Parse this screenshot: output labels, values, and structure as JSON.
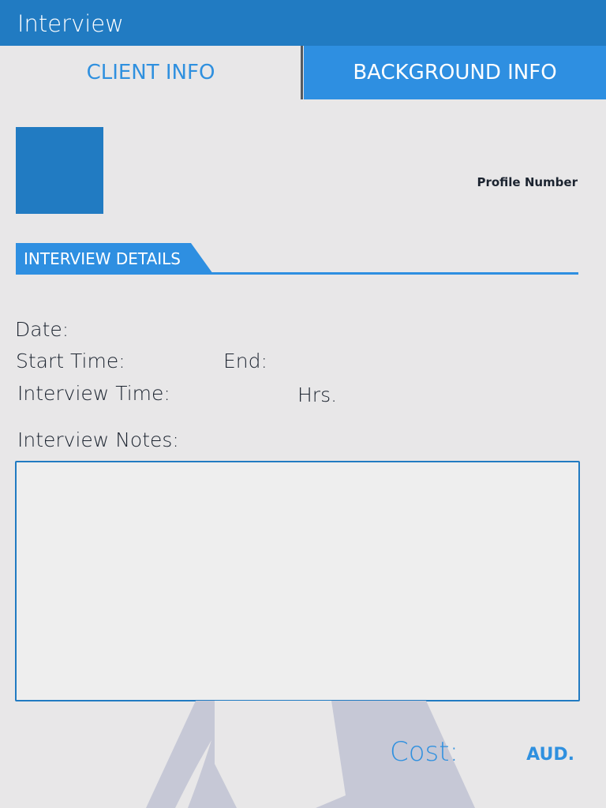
{
  "app_bar": {
    "title": "Interview",
    "color": "#217bc2"
  },
  "tabs": [
    {
      "label": "CLIENT INFO",
      "selected": false
    },
    {
      "label": "BACKGROUND INFO",
      "selected": true
    }
  ],
  "profile": {
    "photo_placeholder_color": "#217bc2",
    "profile_number_label": "Profile Number"
  },
  "interview_details": {
    "section_title": "INTERVIEW DETAILS",
    "date_label": "Date:",
    "start_time_label": "Start Time:",
    "end_label": "End:",
    "interview_time_label": "Interview Time:",
    "hours_unit": "Hrs.",
    "notes_label": "Interview Notes:",
    "notes_value": ""
  },
  "cost": {
    "label": "Cost:",
    "currency": "AUD."
  },
  "colors": {
    "accent": "#2e8fe1",
    "primary_dark": "#217bc2",
    "background": "#e8e7e8",
    "text": "#1c2430"
  }
}
